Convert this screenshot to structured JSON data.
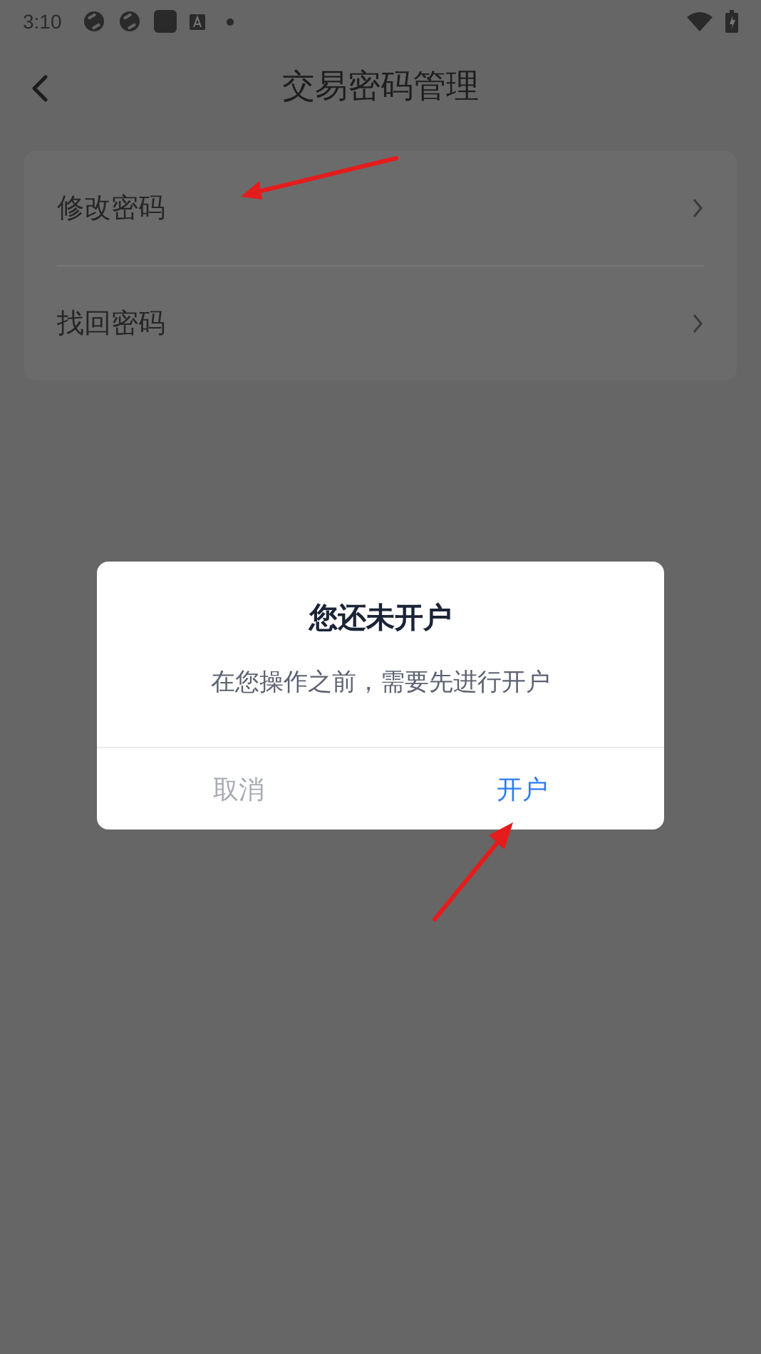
{
  "status_bar": {
    "time": "3:10"
  },
  "header": {
    "title": "交易密码管理"
  },
  "menu_items": [
    {
      "label": "修改密码"
    },
    {
      "label": "找回密码"
    }
  ],
  "dialog": {
    "title": "您还未开户",
    "message": "在您操作之前，需要先进行开户",
    "buttons": [
      {
        "label": "取消",
        "kind": "cancel"
      },
      {
        "label": "开户",
        "kind": "confirm"
      }
    ]
  },
  "annotations": [
    {
      "kind": "arrow"
    },
    {
      "kind": "arrow"
    }
  ]
}
